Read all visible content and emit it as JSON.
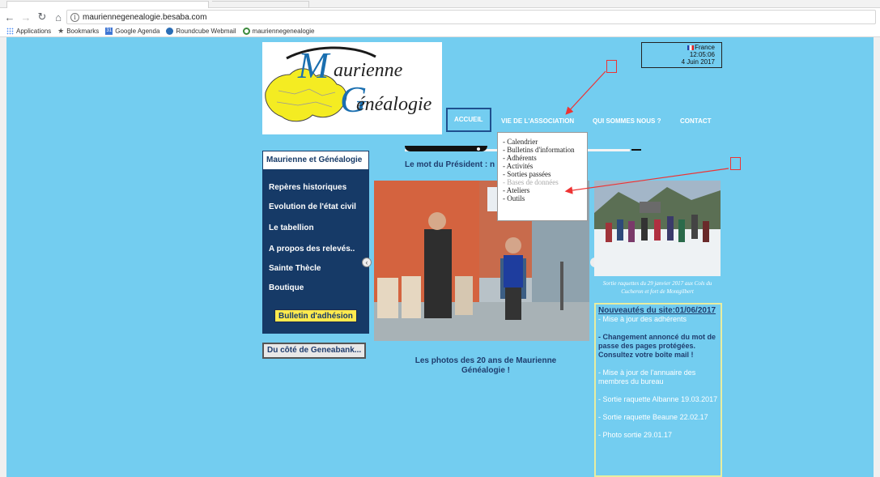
{
  "browser": {
    "url": "mauriennegenealogie.besaba.com",
    "bookmarks": [
      "Applications",
      "Bookmarks",
      "Google Agenda",
      "Roundcube Webmail",
      "mauriennegenealogie"
    ],
    "calendar_icon_text": "31"
  },
  "logo": {
    "line1_initial": "M",
    "line1_rest": "aurienne",
    "line2_initial": "G",
    "line2_rest": "énéalogie"
  },
  "clock": {
    "country": "France",
    "time": "12:05:06",
    "date": "4 Juin 2017"
  },
  "menu": {
    "items": [
      "ACCUEIL",
      "VIE DE L'ASSOCIATION",
      "QUI SOMMES NOUS ?",
      "CONTACT"
    ],
    "active": "ACCUEIL"
  },
  "submenu": {
    "items": [
      "- Calendrier",
      "- Bulletins d'information",
      "- Adhérents",
      "- Activités",
      "- Sorties passées",
      "- Bases de données",
      "- Ateliers",
      "- Outils"
    ],
    "highlighted_index": 5
  },
  "president": {
    "text": "Le mot du Président : n"
  },
  "sidebar": {
    "header": "Maurienne et Généalogie",
    "links": [
      "Repères historiques",
      "Evolution de l'état civil",
      "Le tabellion",
      "A propos des relevés..",
      "Sainte Thècle",
      "Boutique"
    ],
    "cta": "Bulletin d'adhésion"
  },
  "geneabank_button": "Du côté de Geneabank...",
  "main_caption": "Les photos des 20 ans de Maurienne Généalogie !",
  "side_photo_caption": "Sortie raquettes du 29 janvier 2017 aux Cols du Cucheron et fort de Montgilbert",
  "news": {
    "title": "Nouveautés du site:01/06/2017",
    "items": [
      "- Mise à jour des adhérents",
      "- Changement annoncé du mot de passe des pages protégées. Consultez votre boîte mail !",
      "- Mise à jour de l'annuaire des membres du bureau",
      "- Sortie raquette Albanne 19.03.2017",
      "- Sortie raquette Beaune 22.02.17",
      "- Photo sortie 29.01.17"
    ]
  },
  "colors": {
    "page_bg": "#73cdf0",
    "sidebar_bg": "#163a67",
    "cta_bg": "#ffea4e",
    "annotation": "#e33"
  }
}
